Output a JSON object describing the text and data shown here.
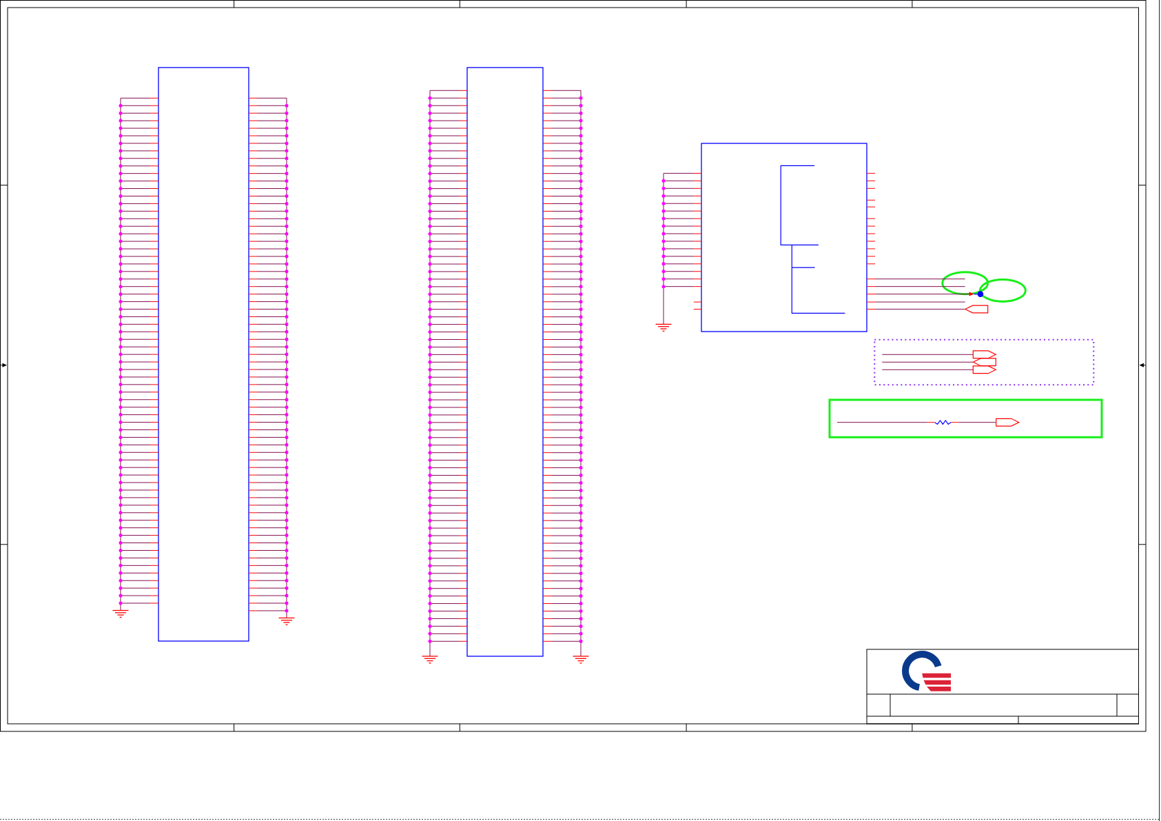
{
  "connectors": [
    {
      "left_pins": [
        {
          "junction": false
        },
        {
          "junction": true
        },
        {
          "junction": true
        },
        {
          "junction": true
        },
        {
          "junction": true
        },
        {
          "junction": true
        },
        {
          "junction": true
        },
        {
          "junction": true
        },
        {
          "junction": true
        },
        {
          "junction": true
        },
        {
          "junction": true
        },
        {
          "junction": true
        },
        {
          "junction": true
        },
        {
          "junction": true
        },
        {
          "junction": true
        },
        {
          "junction": true
        },
        {
          "junction": true
        },
        {
          "junction": true
        },
        {
          "junction": true
        },
        {
          "junction": true
        },
        {
          "junction": true
        },
        {
          "junction": true
        },
        {
          "junction": true
        },
        {
          "junction": true
        },
        {
          "junction": true
        },
        {
          "junction": true
        },
        {
          "junction": true
        },
        {
          "junction": true
        },
        {
          "junction": true
        },
        {
          "junction": true
        },
        {
          "junction": true
        },
        {
          "junction": true
        },
        {
          "junction": true
        },
        {
          "junction": true
        },
        {
          "junction": true
        },
        {
          "junction": true
        },
        {
          "junction": true
        },
        {
          "junction": true
        },
        {
          "junction": true
        },
        {
          "junction": true
        },
        {
          "junction": true
        },
        {
          "junction": true
        },
        {
          "junction": true
        },
        {
          "junction": true
        },
        {
          "junction": true
        },
        {
          "junction": true
        },
        {
          "junction": true
        },
        {
          "junction": true
        },
        {
          "junction": true
        },
        {
          "junction": true
        },
        {
          "junction": true
        },
        {
          "junction": true
        },
        {
          "junction": true
        },
        {
          "junction": true
        },
        {
          "junction": true
        },
        {
          "junction": true
        },
        {
          "junction": true
        },
        {
          "junction": true
        },
        {
          "junction": true
        },
        {
          "junction": true
        },
        {
          "junction": true
        },
        {
          "junction": true
        },
        {
          "junction": true
        },
        {
          "junction": true
        },
        {
          "junction": true
        },
        {
          "junction": true
        },
        {
          "junction": true
        },
        {
          "junction": true
        }
      ],
      "left_ground": true,
      "right_pins": [
        {
          "junction": false
        },
        {
          "junction": true
        },
        {
          "junction": true
        },
        {
          "junction": true
        },
        {
          "junction": true
        },
        {
          "junction": true
        },
        {
          "junction": true
        },
        {
          "junction": true
        },
        {
          "junction": true
        },
        {
          "junction": true
        },
        {
          "junction": true
        },
        {
          "junction": true
        },
        {
          "junction": true
        },
        {
          "junction": true
        },
        {
          "junction": true
        },
        {
          "junction": true
        },
        {
          "junction": true
        },
        {
          "junction": true
        },
        {
          "junction": true
        },
        {
          "junction": true
        },
        {
          "junction": true
        },
        {
          "junction": true
        },
        {
          "junction": true
        },
        {
          "junction": true
        },
        {
          "junction": true
        },
        {
          "junction": true
        },
        {
          "junction": true
        },
        {
          "junction": true
        },
        {
          "junction": true
        },
        {
          "junction": true
        },
        {
          "junction": true
        },
        {
          "junction": true
        },
        {
          "junction": true
        },
        {
          "junction": true
        },
        {
          "junction": true
        },
        {
          "junction": true
        },
        {
          "junction": true
        },
        {
          "junction": true
        },
        {
          "junction": true
        },
        {
          "junction": true
        },
        {
          "junction": true
        },
        {
          "junction": true
        },
        {
          "junction": true
        },
        {
          "junction": true
        },
        {
          "junction": true
        },
        {
          "junction": true
        },
        {
          "junction": true
        },
        {
          "junction": true
        },
        {
          "junction": true
        },
        {
          "junction": true
        },
        {
          "junction": true
        },
        {
          "junction": true
        },
        {
          "junction": true
        },
        {
          "junction": true
        },
        {
          "junction": true
        },
        {
          "junction": true
        },
        {
          "junction": true
        },
        {
          "junction": true
        },
        {
          "junction": true
        },
        {
          "junction": true
        },
        {
          "junction": true
        },
        {
          "junction": true
        },
        {
          "junction": true
        },
        {
          "junction": true
        },
        {
          "junction": true
        },
        {
          "junction": true
        },
        {
          "junction": true
        },
        {
          "junction": true
        },
        {
          "junction": true
        }
      ],
      "right_ground": true
    },
    {
      "left_pins": [
        {
          "junction": false
        },
        {
          "junction": true
        },
        {
          "junction": true
        },
        {
          "junction": true
        },
        {
          "junction": true
        },
        {
          "junction": true
        },
        {
          "junction": true
        },
        {
          "junction": true
        },
        {
          "junction": true
        },
        {
          "junction": true
        },
        {
          "junction": true
        },
        {
          "junction": true
        },
        {
          "junction": true
        },
        {
          "junction": true
        },
        {
          "junction": true
        },
        {
          "junction": true
        },
        {
          "junction": true
        },
        {
          "junction": true
        },
        {
          "junction": true
        },
        {
          "junction": true
        },
        {
          "junction": true
        },
        {
          "junction": true
        },
        {
          "junction": true
        },
        {
          "junction": true
        },
        {
          "junction": true
        },
        {
          "junction": true
        },
        {
          "junction": true
        },
        {
          "junction": true
        },
        {
          "junction": true
        },
        {
          "junction": true
        },
        {
          "junction": true
        },
        {
          "junction": true
        },
        {
          "junction": true
        },
        {
          "junction": true
        },
        {
          "junction": true
        },
        {
          "junction": true
        },
        {
          "junction": true
        },
        {
          "junction": true
        },
        {
          "junction": true
        },
        {
          "junction": true
        },
        {
          "junction": true
        },
        {
          "junction": true
        },
        {
          "junction": true
        },
        {
          "junction": true
        },
        {
          "junction": true
        },
        {
          "junction": true
        },
        {
          "junction": true
        },
        {
          "junction": true
        },
        {
          "junction": true
        },
        {
          "junction": true
        },
        {
          "junction": true
        },
        {
          "junction": true
        },
        {
          "junction": true
        },
        {
          "junction": true
        },
        {
          "junction": true
        },
        {
          "junction": true
        },
        {
          "junction": true
        },
        {
          "junction": true
        },
        {
          "junction": true
        },
        {
          "junction": true
        },
        {
          "junction": true
        },
        {
          "junction": true
        },
        {
          "junction": true
        },
        {
          "junction": true
        },
        {
          "junction": true
        },
        {
          "junction": true
        },
        {
          "junction": true
        },
        {
          "junction": true
        },
        {
          "junction": true
        },
        {
          "junction": true
        },
        {
          "junction": true
        },
        {
          "junction": true
        },
        {
          "junction": true
        },
        {
          "junction": true
        }
      ],
      "left_ground": true,
      "right_pins": [
        {
          "junction": false
        },
        {
          "junction": true
        },
        {
          "junction": true
        },
        {
          "junction": true
        },
        {
          "junction": true
        },
        {
          "junction": true
        },
        {
          "junction": true
        },
        {
          "junction": true
        },
        {
          "junction": true
        },
        {
          "junction": true
        },
        {
          "junction": true
        },
        {
          "junction": true
        },
        {
          "junction": true
        },
        {
          "junction": true
        },
        {
          "junction": true
        },
        {
          "junction": true
        },
        {
          "junction": true
        },
        {
          "junction": true
        },
        {
          "junction": true
        },
        {
          "junction": true
        },
        {
          "junction": true
        },
        {
          "junction": true
        },
        {
          "junction": true
        },
        {
          "junction": true
        },
        {
          "junction": true
        },
        {
          "junction": true
        },
        {
          "junction": true
        },
        {
          "junction": true
        },
        {
          "junction": true
        },
        {
          "junction": true
        },
        {
          "junction": true
        },
        {
          "junction": true
        },
        {
          "junction": true
        },
        {
          "junction": true
        },
        {
          "junction": true
        },
        {
          "junction": true
        },
        {
          "junction": true
        },
        {
          "junction": true
        },
        {
          "junction": true
        },
        {
          "junction": true
        },
        {
          "junction": true
        },
        {
          "junction": true
        },
        {
          "junction": true
        },
        {
          "junction": true
        },
        {
          "junction": true
        },
        {
          "junction": true
        },
        {
          "junction": true
        },
        {
          "junction": true
        },
        {
          "junction": true
        },
        {
          "junction": true
        },
        {
          "junction": true
        },
        {
          "junction": true
        },
        {
          "junction": true
        },
        {
          "junction": true
        },
        {
          "junction": true
        },
        {
          "junction": true
        },
        {
          "junction": true
        },
        {
          "junction": true
        },
        {
          "junction": true
        },
        {
          "junction": true
        },
        {
          "junction": true
        },
        {
          "junction": true
        },
        {
          "junction": true
        },
        {
          "junction": true
        },
        {
          "junction": true
        },
        {
          "junction": true
        },
        {
          "junction": true
        },
        {
          "junction": true
        },
        {
          "junction": true
        },
        {
          "junction": true
        },
        {
          "junction": true
        },
        {
          "junction": true
        },
        {
          "junction": true
        },
        {
          "junction": true
        }
      ],
      "right_ground": true
    }
  ],
  "chip": {
    "left_pins": [
      {
        "kind": "bus",
        "junction": false
      },
      {
        "kind": "bus",
        "junction": true
      },
      {
        "kind": "bus",
        "junction": true
      },
      {
        "kind": "bus",
        "junction": true
      },
      {
        "kind": "bus",
        "junction": true
      },
      {
        "kind": "bus",
        "junction": true
      },
      {
        "kind": "bus",
        "junction": true
      },
      {
        "kind": "bus",
        "junction": true
      },
      {
        "kind": "bus",
        "junction": true
      },
      {
        "kind": "bus",
        "junction": true
      },
      {
        "kind": "bus",
        "junction": true
      },
      {
        "kind": "bus",
        "junction": true
      },
      {
        "kind": "bus",
        "junction": true
      },
      {
        "kind": "bus",
        "junction": true
      },
      {
        "kind": "bus",
        "junction": true
      },
      {
        "kind": "bus",
        "junction": true
      },
      {
        "kind": "open",
        "junction": false
      },
      {
        "kind": "open",
        "junction": false
      }
    ],
    "ground": true,
    "right_pins": [
      {
        "kind": "open"
      },
      {
        "kind": "open"
      },
      {
        "kind": "open"
      },
      {
        "kind": "open"
      },
      {
        "kind": "open"
      },
      {
        "kind": "open"
      },
      {
        "kind": "open"
      },
      {
        "kind": "open"
      },
      {
        "kind": "open"
      },
      {
        "kind": "open"
      },
      {
        "kind": "open"
      },
      {
        "kind": "open"
      },
      {
        "kind": "wire"
      },
      {
        "kind": "wire"
      },
      {
        "kind": "probe"
      },
      {
        "kind": "wire"
      },
      {
        "kind": "port"
      }
    ]
  },
  "highlights": [
    {
      "kind": "ellipse"
    },
    {
      "kind": "ellipse"
    }
  ],
  "port_group": {
    "outlined": true,
    "ports": [
      {
        "kind": "output"
      },
      {
        "kind": "input"
      },
      {
        "kind": "output"
      }
    ]
  },
  "resistor_net": {
    "highlighted": true,
    "port": {
      "kind": "output"
    }
  }
}
